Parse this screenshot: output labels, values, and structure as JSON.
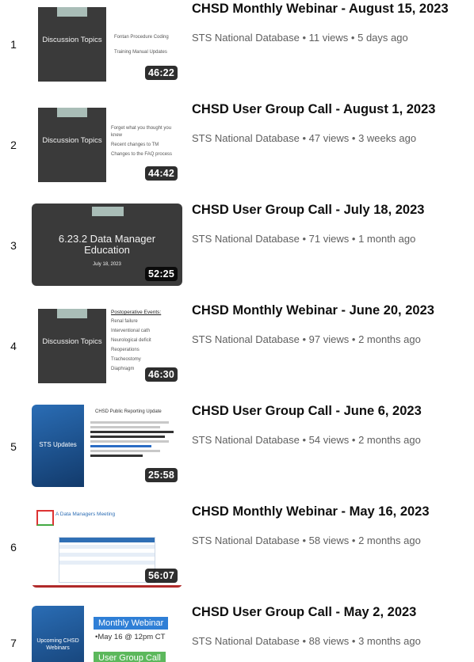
{
  "videos": [
    {
      "index": "1",
      "title": "CHSD Monthly Webinar - August 15, 2023",
      "channel": "STS National Database",
      "views": "11 views",
      "age": "5 days ago",
      "duration": "46:22",
      "thumb": {
        "main": "Discussion Topics",
        "bullets": [
          "Fontan Procedure Coding",
          "Training Manual Updates"
        ]
      }
    },
    {
      "index": "2",
      "title": "CHSD User Group Call - August 1, 2023",
      "channel": "STS National Database",
      "views": "47 views",
      "age": "3 weeks ago",
      "duration": "44:42",
      "thumb": {
        "main": "Discussion Topics",
        "bullets": [
          "Forget what you thought you knew",
          "Recent changes to TM",
          "Changes to the FAQ process"
        ]
      }
    },
    {
      "index": "3",
      "title": "CHSD User Group Call - July 18, 2023",
      "channel": "STS National Database",
      "views": "71 views",
      "age": "1 month ago",
      "duration": "52:25",
      "thumb": {
        "main": "6.23.2 Data Manager Education",
        "sub": "July 18, 2023"
      }
    },
    {
      "index": "4",
      "title": "CHSD Monthly Webinar - June 20, 2023",
      "channel": "STS National Database",
      "views": "97 views",
      "age": "2 months ago",
      "duration": "46:30",
      "thumb": {
        "main": "Discussion Topics",
        "heading": "Postoperative Events:",
        "bullets": [
          "Renal failure",
          "Interventional cath",
          "Neurological deficit",
          "Reoperations",
          "Tracheostomy",
          "Diaphragm"
        ]
      }
    },
    {
      "index": "5",
      "title": "CHSD User Group Call - June 6, 2023",
      "channel": "STS National Database",
      "views": "54 views",
      "age": "2 months ago",
      "duration": "25:58",
      "thumb": {
        "main": "STS Updates",
        "heading": "CHSD Public Reporting Update"
      }
    },
    {
      "index": "6",
      "title": "CHSD Monthly Webinar - May 16, 2023",
      "channel": "STS National Database",
      "views": "58 views",
      "age": "2 months ago",
      "duration": "56:07",
      "thumb": {
        "main": "A Data Managers Meeting"
      }
    },
    {
      "index": "7",
      "title": "CHSD User Group Call - May 2, 2023",
      "channel": "STS National Database",
      "views": "88 views",
      "age": "3 months ago",
      "duration": "",
      "thumb": {
        "main": "Upcoming CHSD Webinars",
        "badge1": "Monthly Webinar",
        "line": "•May 16 @ 12pm CT",
        "badge2": "User Group Call"
      }
    }
  ],
  "separator": "•",
  "colors": {
    "title": "#0f0f0f",
    "meta": "#606060",
    "slide_dark": "#3a3a3a",
    "slide_tab": "#a9bdb7",
    "sts_blue": "#1b4f8c",
    "green": "#5cb85c",
    "badge_blue": "#2f7fd6"
  }
}
